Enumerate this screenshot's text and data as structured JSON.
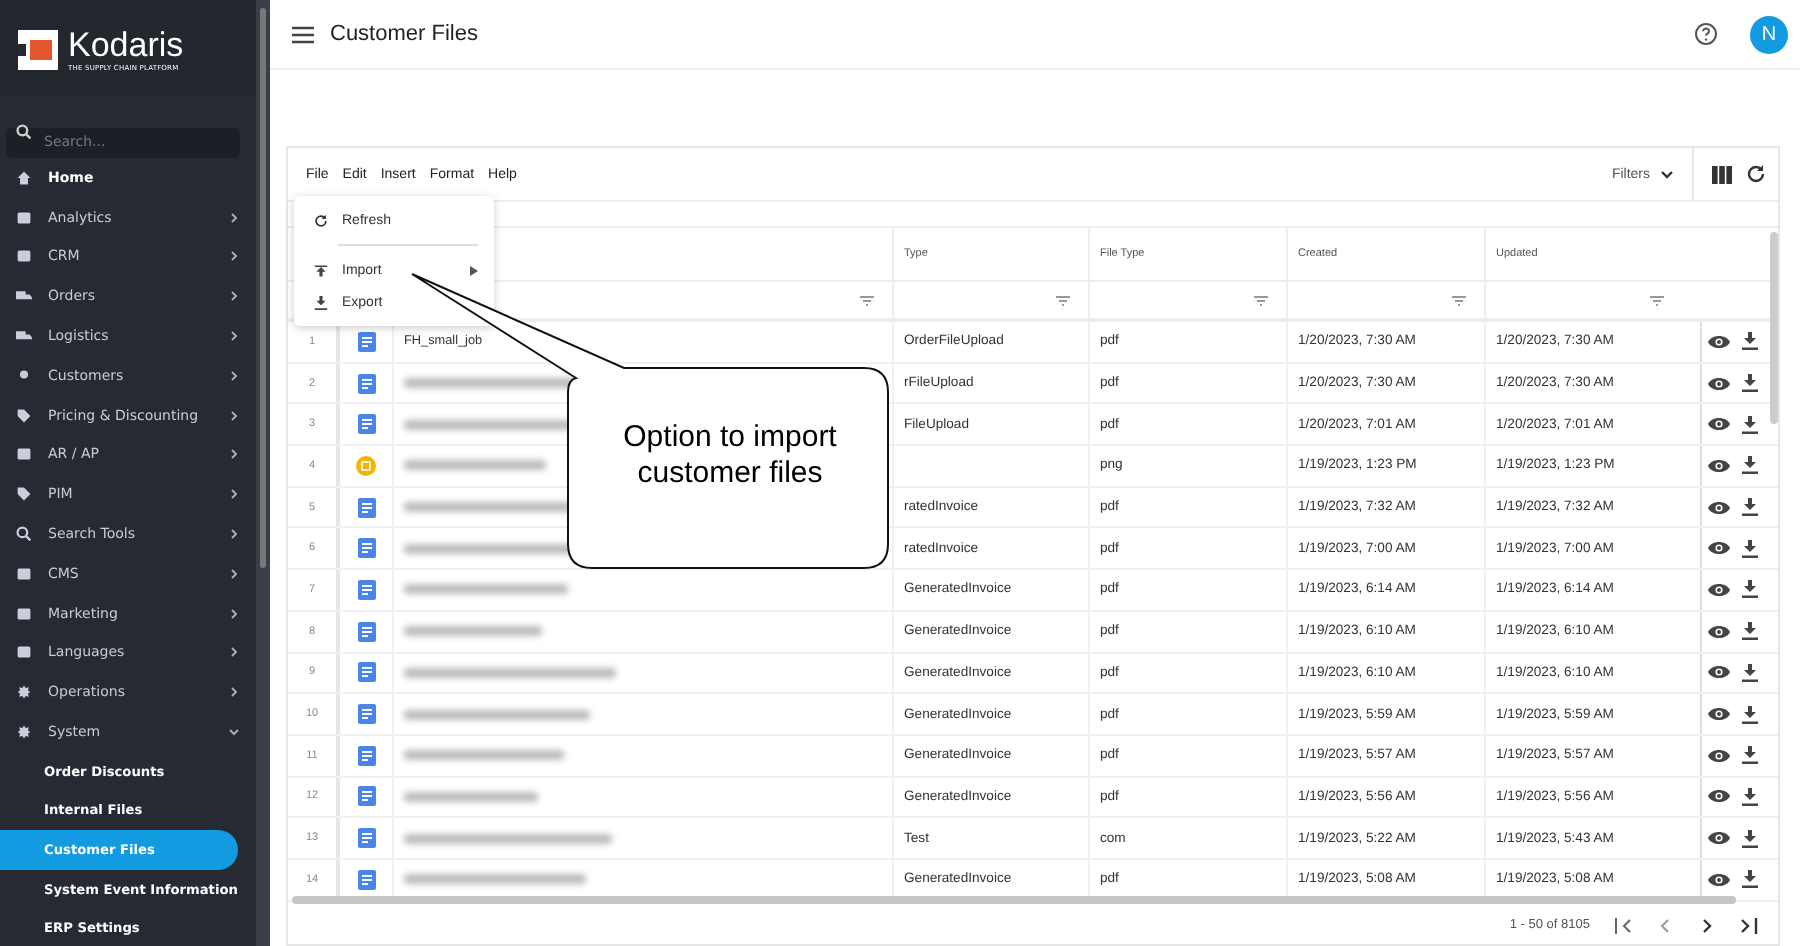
{
  "sidebar": {
    "brand": "Kodaris",
    "tagline": "THE SUPPLY CHAIN PLATFORM",
    "search": {
      "placeholder": "Search..."
    },
    "items": [
      {
        "label": "Home"
      },
      {
        "label": "Analytics",
        "expanded": false
      },
      {
        "label": "CRM",
        "expanded": false
      },
      {
        "label": "Orders",
        "expanded": false
      },
      {
        "label": "Logistics",
        "expanded": false
      },
      {
        "label": "Customers",
        "expanded": false
      },
      {
        "label": "Pricing & Discounting",
        "expanded": false
      },
      {
        "label": "AR / AP",
        "expanded": false
      },
      {
        "label": "PIM",
        "expanded": false
      },
      {
        "label": "Search Tools",
        "expanded": false
      },
      {
        "label": "CMS",
        "expanded": false
      },
      {
        "label": "Marketing",
        "expanded": false
      },
      {
        "label": "Languages",
        "expanded": false
      },
      {
        "label": "Operations",
        "expanded": false
      },
      {
        "label": "System",
        "expanded": true,
        "children": [
          {
            "label": "Order Discounts",
            "selected": false
          },
          {
            "label": "Internal Files",
            "selected": false
          },
          {
            "label": "Customer Files",
            "selected": true
          },
          {
            "label": "System Event Information",
            "selected": false
          },
          {
            "label": "ERP Settings",
            "selected": false
          }
        ]
      }
    ]
  },
  "header": {
    "title": "Customer Files",
    "avatar": "N"
  },
  "toolbar": {
    "menus": [
      "File",
      "Edit",
      "Insert",
      "Format",
      "Help"
    ],
    "filters": "Filters"
  },
  "file_menu": {
    "items": [
      {
        "label": "Refresh",
        "kind": "refresh"
      },
      {
        "kind": "divider"
      },
      {
        "label": "Import",
        "kind": "submenu"
      },
      {
        "label": "Export",
        "kind": "export"
      }
    ]
  },
  "table": {
    "columns": [
      "Type",
      "File Type",
      "Created",
      "Updated"
    ],
    "rows": [
      {
        "num": "1",
        "kind": "doc",
        "name": "FH_small_job",
        "type": "OrderFileUpload",
        "file_type": "pdf",
        "created": "1/20/2023, 7:30 AM",
        "updated": "1/20/2023, 7:30 AM"
      },
      {
        "num": "2",
        "kind": "doc",
        "type": "rFileUpload",
        "file_type": "pdf",
        "created": "1/20/2023, 7:30 AM",
        "updated": "1/20/2023, 7:30 AM"
      },
      {
        "num": "3",
        "kind": "doc",
        "type": "FileUpload",
        "file_type": "pdf",
        "created": "1/20/2023, 7:01 AM",
        "updated": "1/20/2023, 7:01 AM"
      },
      {
        "num": "4",
        "kind": "image",
        "file_type": "png",
        "created": "1/19/2023, 1:23 PM",
        "updated": "1/19/2023, 1:23 PM"
      },
      {
        "num": "5",
        "kind": "doc",
        "type": "ratedInvoice",
        "file_type": "pdf",
        "created": "1/19/2023, 7:32 AM",
        "updated": "1/19/2023, 7:32 AM"
      },
      {
        "num": "6",
        "kind": "doc",
        "type": "ratedInvoice",
        "file_type": "pdf",
        "created": "1/19/2023, 7:00 AM",
        "updated": "1/19/2023, 7:00 AM"
      },
      {
        "num": "7",
        "kind": "doc",
        "type": "GeneratedInvoice",
        "file_type": "pdf",
        "created": "1/19/2023, 6:14 AM",
        "updated": "1/19/2023, 6:14 AM"
      },
      {
        "num": "8",
        "kind": "doc",
        "type": "GeneratedInvoice",
        "file_type": "pdf",
        "created": "1/19/2023, 6:10 AM",
        "updated": "1/19/2023, 6:10 AM"
      },
      {
        "num": "9",
        "kind": "doc",
        "type": "GeneratedInvoice",
        "file_type": "pdf",
        "created": "1/19/2023, 6:10 AM",
        "updated": "1/19/2023, 6:10 AM"
      },
      {
        "num": "10",
        "kind": "doc",
        "type": "GeneratedInvoice",
        "file_type": "pdf",
        "created": "1/19/2023, 5:59 AM",
        "updated": "1/19/2023, 5:59 AM"
      },
      {
        "num": "11",
        "kind": "doc",
        "type": "GeneratedInvoice",
        "file_type": "pdf",
        "created": "1/19/2023, 5:57 AM",
        "updated": "1/19/2023, 5:57 AM"
      },
      {
        "num": "12",
        "kind": "doc",
        "type": "GeneratedInvoice",
        "file_type": "pdf",
        "created": "1/19/2023, 5:56 AM",
        "updated": "1/19/2023, 5:56 AM"
      },
      {
        "num": "13",
        "kind": "doc",
        "type": "Test",
        "file_type": "com",
        "created": "1/19/2023, 5:22 AM",
        "updated": "1/19/2023, 5:43 AM"
      },
      {
        "num": "14",
        "kind": "doc",
        "type": "GeneratedInvoice",
        "file_type": "pdf",
        "created": "1/19/2023, 5:08 AM",
        "updated": "1/19/2023, 5:08 AM"
      }
    ]
  },
  "pagination": {
    "range": "1 - 50 of 8105"
  },
  "callout": {
    "text": "Option to import customer files"
  }
}
